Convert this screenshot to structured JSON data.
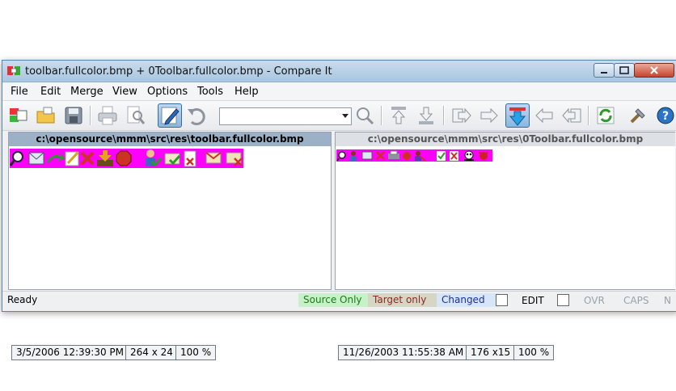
{
  "window": {
    "title": "toolbar.fullcolor.bmp + 0Toolbar.fullcolor.bmp - Compare It"
  },
  "menu": [
    "File",
    "Edit",
    "Merge",
    "View",
    "Options",
    "Tools",
    "Help"
  ],
  "toolbar": {
    "icons": [
      "compare-icon",
      "open-icon",
      "save-icon",
      "print-icon",
      "print-preview-icon",
      "edit-pencil-icon",
      "undo-icon",
      "search-icon",
      "move-up-icon",
      "move-down-icon",
      "copy-right-icon",
      "copy-to-right-icon",
      "next-difference-icon",
      "copy-left-icon",
      "copy-to-left-icon",
      "refresh-icon",
      "tools-icon",
      "help-icon"
    ],
    "combo_value": ""
  },
  "left_pane": {
    "path": "c:\\opensource\\mmm\\src\\res\\toolbar.fullcolor.bmp",
    "date": "3/5/2006  12:39:30 PM",
    "size": "264 x 24",
    "zoom": "100 %"
  },
  "right_pane": {
    "path": "c:\\opensource\\mmm\\src\\res\\0Toolbar.fullcolor.bmp",
    "date": "11/26/2003  11:55:38 AM",
    "size": "176 x15",
    "zoom": "100 %"
  },
  "status": {
    "ready": "Ready",
    "source_only": "Source Only",
    "target_only": "Target only",
    "changed": "Changed",
    "edit": "EDIT",
    "ovr": "OVR",
    "caps": "CAPS",
    "num": "N",
    "colors": {
      "source_only": "#1a7a1a",
      "target_only": "#8a2a22",
      "changed": "#1a2f9a"
    }
  }
}
